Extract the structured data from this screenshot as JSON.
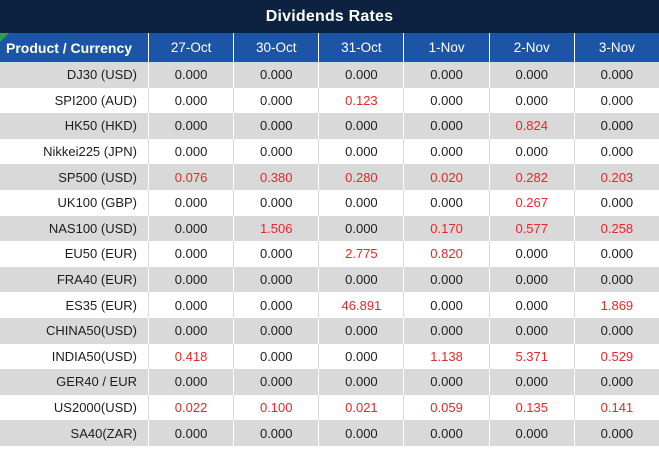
{
  "window": {
    "title": "Dividends Rates"
  },
  "table": {
    "columns": [
      "Product / Currency",
      "27-Oct",
      "30-Oct",
      "31-Oct",
      "1-Nov",
      "2-Nov",
      "3-Nov"
    ],
    "rows": [
      {
        "product": "DJ30 (USD)",
        "values": [
          "0.000",
          "0.000",
          "0.000",
          "0.000",
          "0.000",
          "0.000"
        ]
      },
      {
        "product": "SPI200 (AUD)",
        "values": [
          "0.000",
          "0.000",
          "0.123",
          "0.000",
          "0.000",
          "0.000"
        ]
      },
      {
        "product": "HK50 (HKD)",
        "values": [
          "0.000",
          "0.000",
          "0.000",
          "0.000",
          "0.824",
          "0.000"
        ]
      },
      {
        "product": "Nikkei225 (JPN)",
        "values": [
          "0.000",
          "0.000",
          "0.000",
          "0.000",
          "0.000",
          "0.000"
        ]
      },
      {
        "product": "SP500 (USD)",
        "values": [
          "0.076",
          "0.380",
          "0.280",
          "0.020",
          "0.282",
          "0.203"
        ]
      },
      {
        "product": "UK100 (GBP)",
        "values": [
          "0.000",
          "0.000",
          "0.000",
          "0.000",
          "0.267",
          "0.000"
        ]
      },
      {
        "product": "NAS100 (USD)",
        "values": [
          "0.000",
          "1.506",
          "0.000",
          "0.170",
          "0.577",
          "0.258"
        ]
      },
      {
        "product": "EU50 (EUR)",
        "values": [
          "0.000",
          "0.000",
          "2.775",
          "0.820",
          "0.000",
          "0.000"
        ]
      },
      {
        "product": "FRA40 (EUR)",
        "values": [
          "0.000",
          "0.000",
          "0.000",
          "0.000",
          "0.000",
          "0.000"
        ]
      },
      {
        "product": "ES35 (EUR)",
        "values": [
          "0.000",
          "0.000",
          "46.891",
          "0.000",
          "0.000",
          "1.869"
        ]
      },
      {
        "product": "CHINA50(USD)",
        "values": [
          "0.000",
          "0.000",
          "0.000",
          "0.000",
          "0.000",
          "0.000"
        ]
      },
      {
        "product": "INDIA50(USD)",
        "values": [
          "0.418",
          "0.000",
          "0.000",
          "1.138",
          "5.371",
          "0.529"
        ]
      },
      {
        "product": "GER40 / EUR",
        "values": [
          "0.000",
          "0.000",
          "0.000",
          "0.000",
          "0.000",
          "0.000"
        ]
      },
      {
        "product": "US2000(USD)",
        "values": [
          "0.022",
          "0.100",
          "0.021",
          "0.059",
          "0.135",
          "0.141"
        ]
      },
      {
        "product": "SA40(ZAR)",
        "values": [
          "0.000",
          "0.000",
          "0.000",
          "0.000",
          "0.000",
          "0.000"
        ]
      }
    ]
  },
  "colors": {
    "title_bar": "#0d2240",
    "header_blue": "#1c55a5",
    "row_gray": "#d9d9d9",
    "row_white": "#ffffff",
    "value_red": "#ee2428",
    "value_black": "#1d1d1d",
    "corner_flag_green": "#2e9e4f"
  }
}
